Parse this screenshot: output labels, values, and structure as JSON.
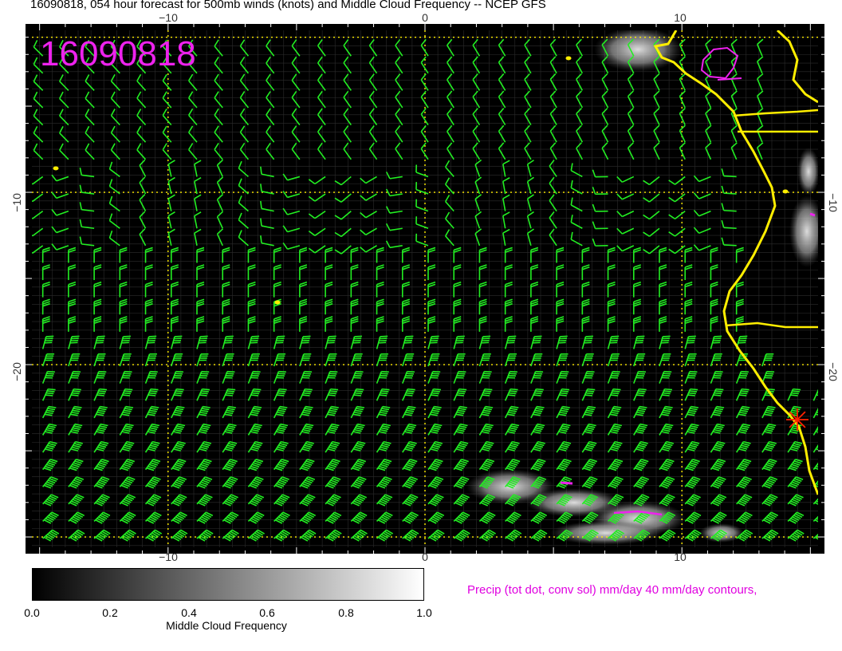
{
  "title": "16090818, 054 hour forecast for 500mb winds (knots) and Middle Cloud Frequency -- NCEP GFS",
  "stamp": "16090818",
  "map": {
    "lon_ticks": [
      "−10",
      "0",
      "10"
    ],
    "lat_ticks": [
      "−10",
      "−20"
    ],
    "lon_range": [
      -15.3,
      15.3
    ],
    "lat_range": [
      -30.6,
      -0.6
    ],
    "colors": {
      "background": "#000000",
      "barbs": "#22ee22",
      "coast": "#ffee00",
      "grid": "#ffee00",
      "precip": "#ee22ee",
      "cloud": "#d0d0d0",
      "marker": "#ff2200"
    }
  },
  "colorbar": {
    "labels": [
      "0.0",
      "0.2",
      "0.4",
      "0.6",
      "0.8",
      "1.0"
    ],
    "title": "Middle Cloud Frequency"
  },
  "precip_note": "Precip (tot dot, conv sol) mm/day 40 mm/day contours,"
}
